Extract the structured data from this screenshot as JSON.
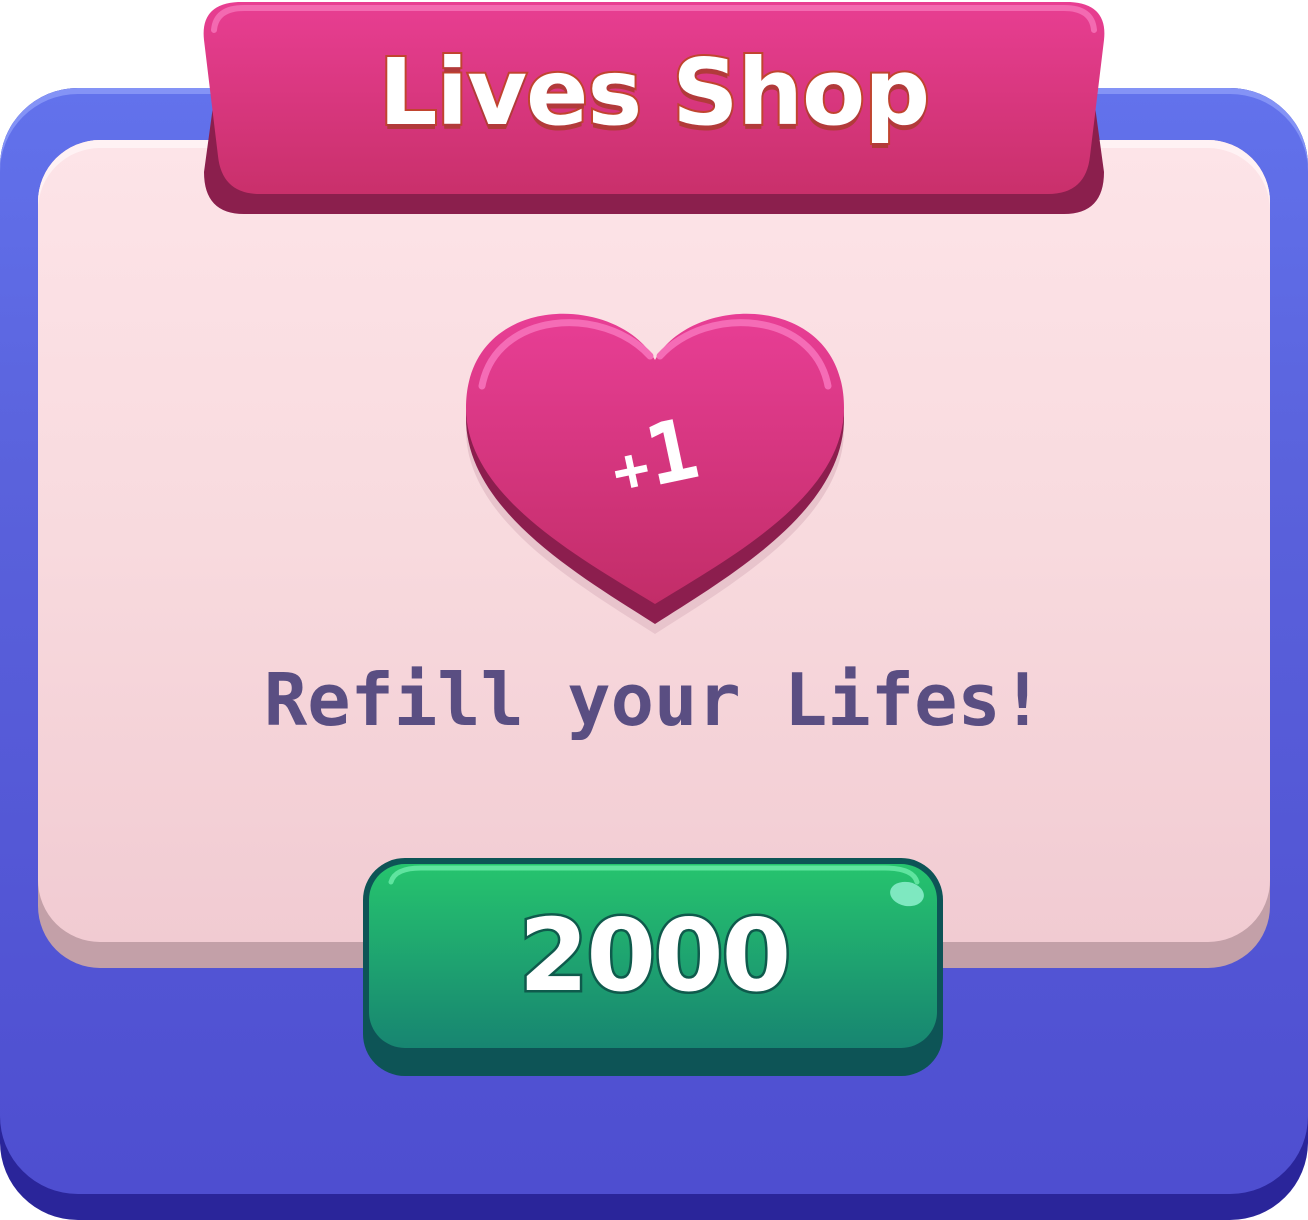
{
  "shop": {
    "title": "Lives Shop",
    "heart_plus": "+",
    "heart_amount": "1",
    "subtitle": "Refill your Lifes!",
    "price": "2000"
  },
  "icons": {
    "item": "heart-icon"
  },
  "colors": {
    "panel_blue": "#5a62dc",
    "panel_dark": "#2a259a",
    "card_pink": "#f8dade",
    "ribbon_pink": "#e23f91",
    "ribbon_shadow": "#8b1f4d",
    "heart_pink": "#d8367f",
    "button_green": "#22b86e",
    "button_dark": "#0d5456",
    "subtitle_text": "#5a4e82"
  }
}
